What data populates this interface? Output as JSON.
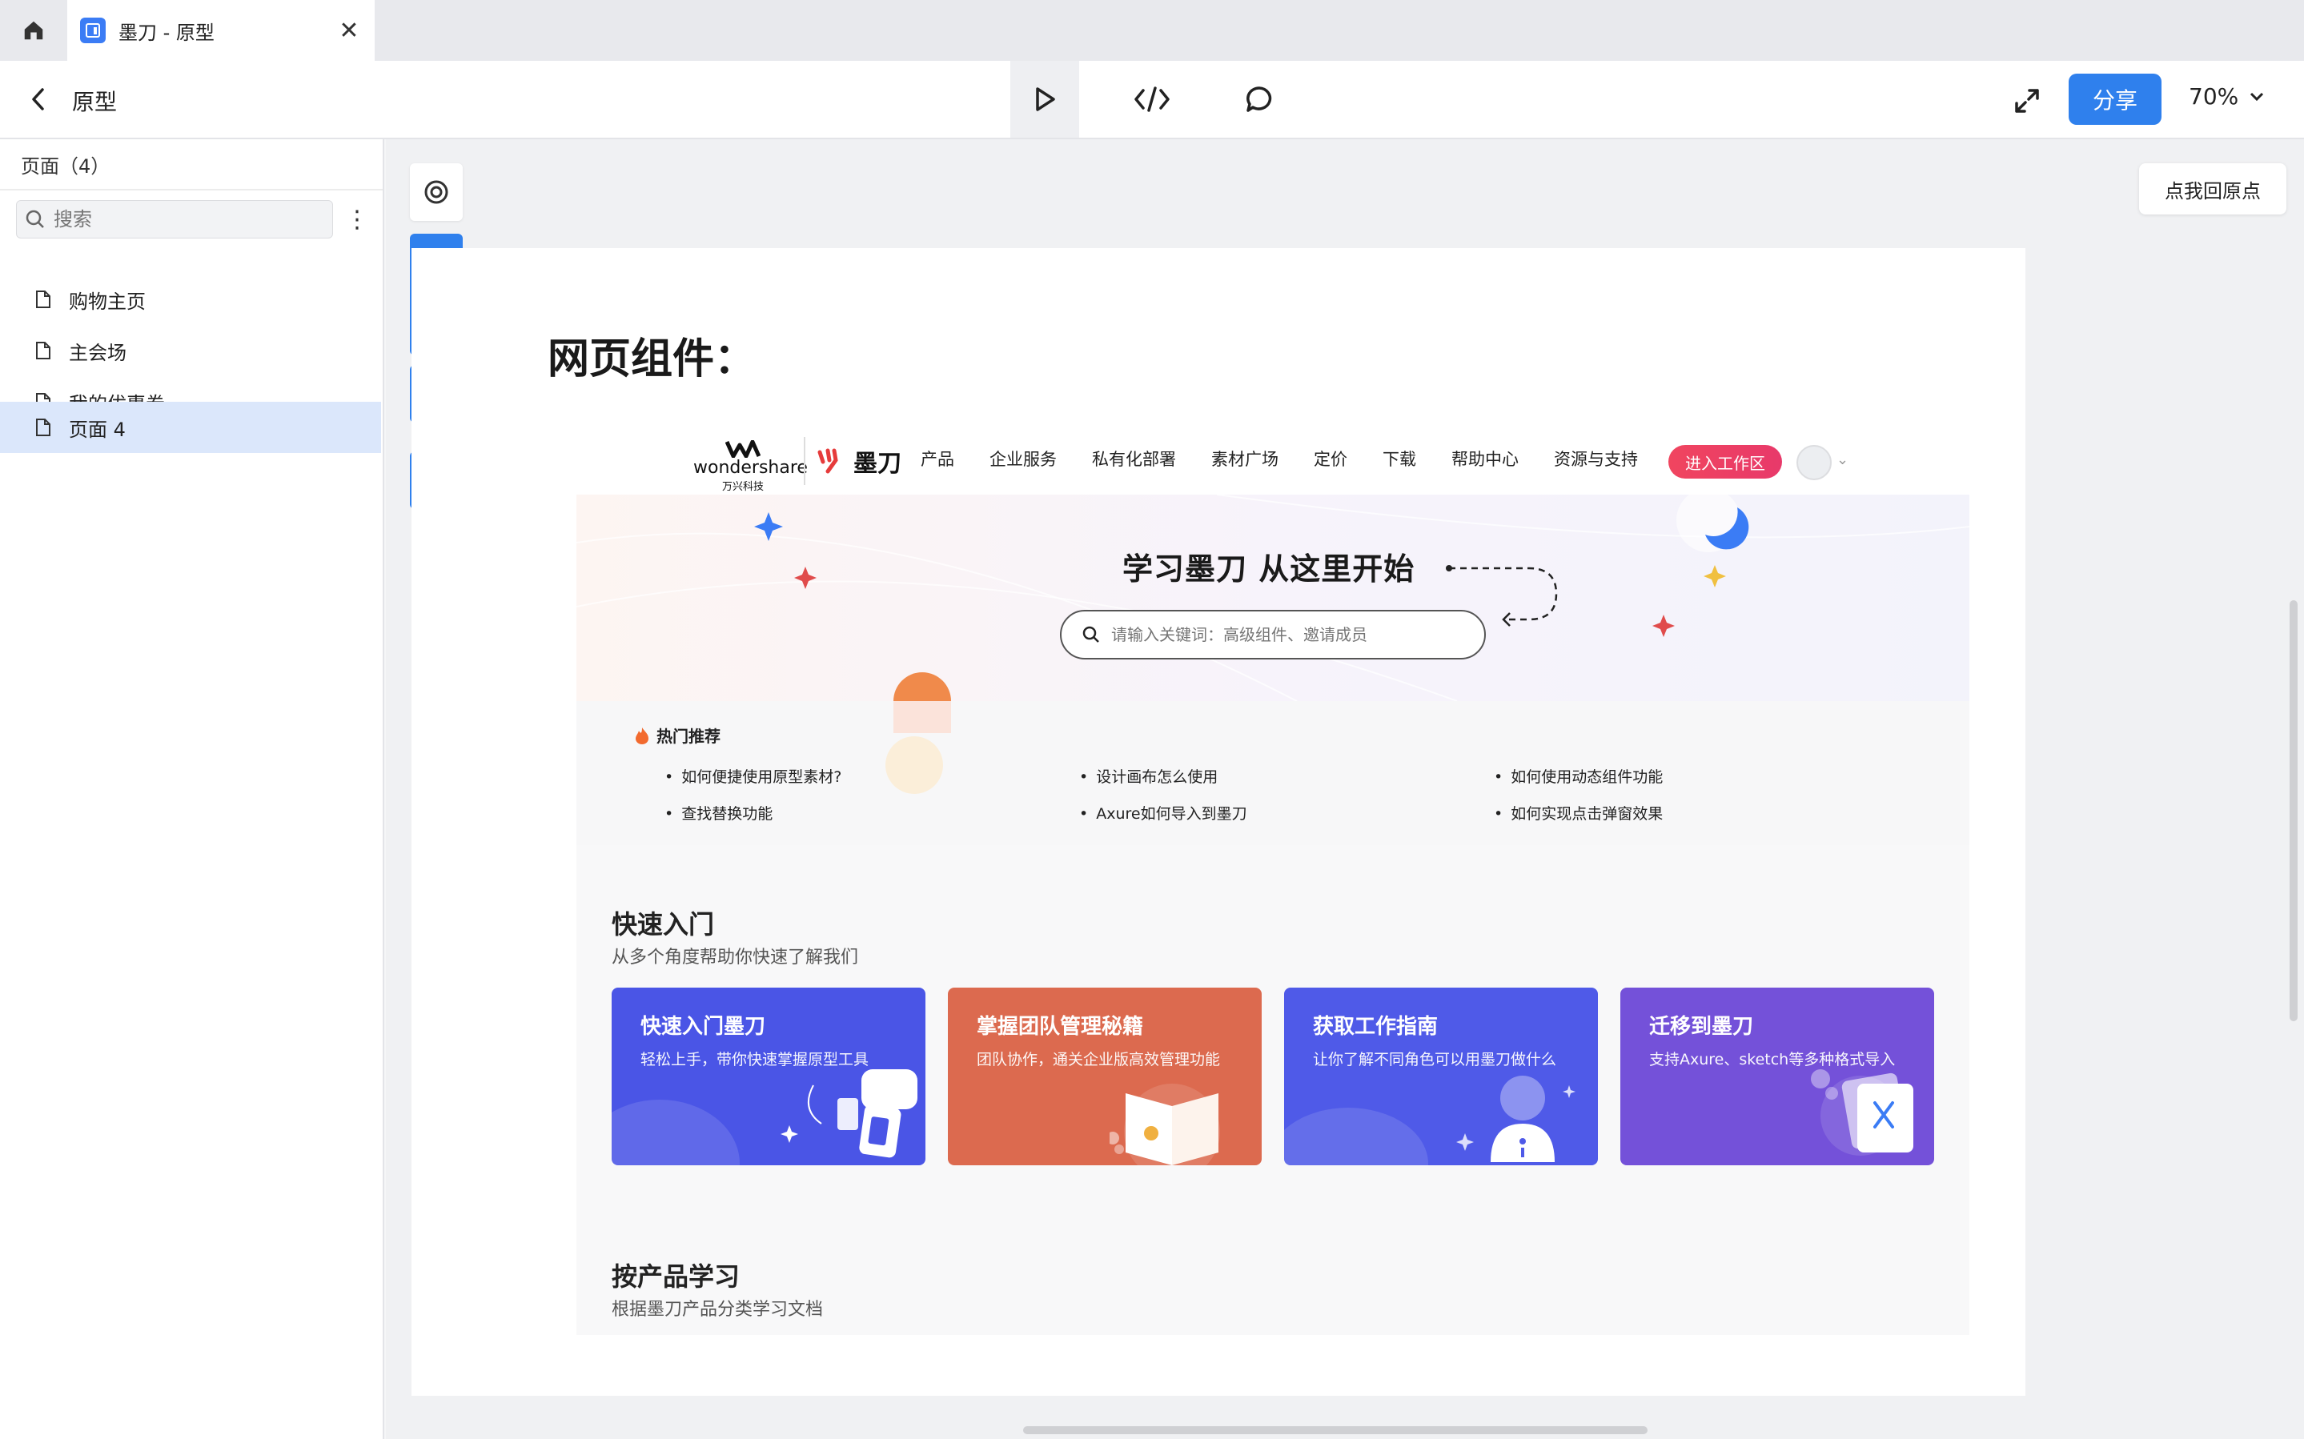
{
  "tab": {
    "title": "墨刀 - 原型",
    "app_icon": "modao-app-icon"
  },
  "toolbar": {
    "page_title": "原型",
    "share_label": "分享",
    "zoom": "70%",
    "tools": [
      "play-icon",
      "code-icon",
      "comment-icon"
    ]
  },
  "sidebar": {
    "header": "页面（4）",
    "search_placeholder": "搜索",
    "pages": [
      {
        "label": "购物主页",
        "active": false
      },
      {
        "label": "主会场",
        "active": false
      },
      {
        "label": "我的优惠券",
        "active": false
      },
      {
        "label": "页面 4",
        "active": true
      }
    ]
  },
  "canvas": {
    "reset_label": "点我回原点",
    "artboard_title": "网页组件："
  },
  "site": {
    "ws_logo_text": "wondershare",
    "ws_logo_sub": "万兴科技",
    "md_logo_text": "墨刀",
    "nav": [
      "产品",
      "企业服务",
      "私有化部署",
      "素材广场",
      "定价",
      "下载",
      "帮助中心",
      "资源与支持"
    ],
    "enter_label": "进入工作区",
    "hero_title": "学习墨刀  从这里开始",
    "hero_search_placeholder": "请输入关键词：高级组件、邀请成员",
    "hot_title": "热门推荐",
    "hot_items": [
      "如何便捷使用原型素材?",
      "设计画布怎么使用",
      "如何使用动态组件功能",
      "查找替换功能",
      "Axure如何导入到墨刀",
      "如何实现点击弹窗效果"
    ],
    "quick_title": "快速入门",
    "quick_sub": "从多个角度帮助你快速了解我们",
    "cards": [
      {
        "title": "快速入门墨刀",
        "sub": "轻松上手，带你快速掌握原型工具",
        "color": "#4a55e6"
      },
      {
        "title": "掌握团队管理秘籍",
        "sub": "团队协作，通关企业版高效管理功能",
        "color": "#dc6a4f"
      },
      {
        "title": "获取工作指南",
        "sub": "让你了解不同角色可以用墨刀做什么",
        "color": "#4f5ae8"
      },
      {
        "title": "迁移到墨刀",
        "sub": "支持Axure、sketch等多种格式导入",
        "color": "#7451d9"
      }
    ],
    "learn_title": "按产品学习",
    "learn_sub": "根据墨刀产品分类学习文档"
  }
}
